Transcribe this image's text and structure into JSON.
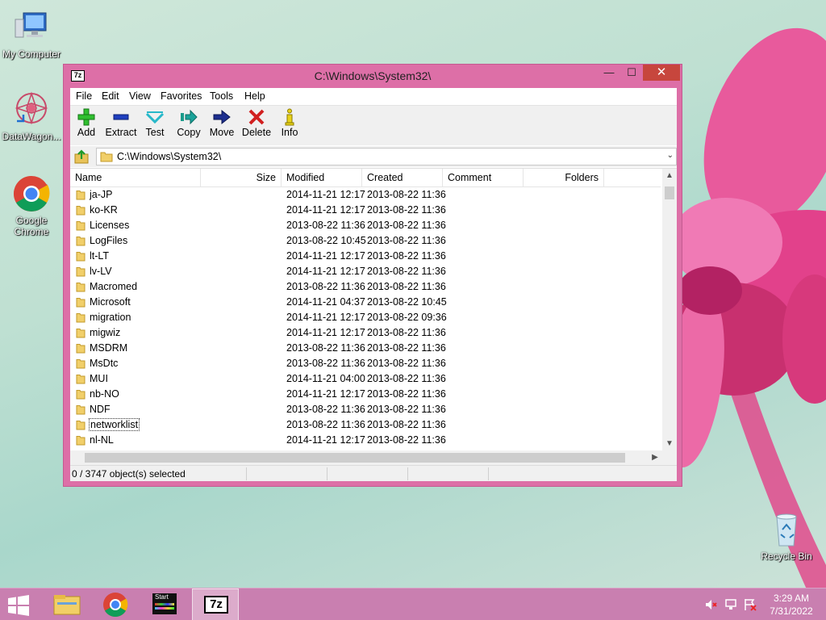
{
  "desktop": {
    "icons": [
      {
        "label": "My Computer"
      },
      {
        "label": "DataWagon..."
      },
      {
        "label": "Google Chrome"
      },
      {
        "label": "Recycle Bin"
      }
    ]
  },
  "window": {
    "app_icon_text": "7z",
    "title": "C:\\Windows\\System32\\",
    "controls": {
      "minimize": "—",
      "maximize": "☐",
      "close": "✕"
    }
  },
  "menu": [
    "File",
    "Edit",
    "View",
    "Favorites",
    "Tools",
    "Help"
  ],
  "toolbar": {
    "add": "Add",
    "extract": "Extract",
    "test": "Test",
    "copy": "Copy",
    "move": "Move",
    "delete": "Delete",
    "info": "Info"
  },
  "address": {
    "path": "C:\\Windows\\System32\\",
    "dropdown": "⌄"
  },
  "columns": {
    "name": "Name",
    "size": "Size",
    "modified": "Modified",
    "created": "Created",
    "comment": "Comment",
    "folders": "Folders"
  },
  "rows": [
    {
      "name": "ja-JP",
      "modified": "2014-11-21 12:17",
      "created": "2013-08-22 11:36"
    },
    {
      "name": "ko-KR",
      "modified": "2014-11-21 12:17",
      "created": "2013-08-22 11:36"
    },
    {
      "name": "Licenses",
      "modified": "2013-08-22 11:36",
      "created": "2013-08-22 11:36"
    },
    {
      "name": "LogFiles",
      "modified": "2013-08-22 10:45",
      "created": "2013-08-22 11:36"
    },
    {
      "name": "lt-LT",
      "modified": "2014-11-21 12:17",
      "created": "2013-08-22 11:36"
    },
    {
      "name": "lv-LV",
      "modified": "2014-11-21 12:17",
      "created": "2013-08-22 11:36"
    },
    {
      "name": "Macromed",
      "modified": "2013-08-22 11:36",
      "created": "2013-08-22 11:36"
    },
    {
      "name": "Microsoft",
      "modified": "2014-11-21 04:37",
      "created": "2013-08-22 10:45"
    },
    {
      "name": "migration",
      "modified": "2014-11-21 12:17",
      "created": "2013-08-22 09:36"
    },
    {
      "name": "migwiz",
      "modified": "2014-11-21 12:17",
      "created": "2013-08-22 11:36"
    },
    {
      "name": "MSDRM",
      "modified": "2013-08-22 11:36",
      "created": "2013-08-22 11:36"
    },
    {
      "name": "MsDtc",
      "modified": "2013-08-22 11:36",
      "created": "2013-08-22 11:36"
    },
    {
      "name": "MUI",
      "modified": "2014-11-21 04:00",
      "created": "2013-08-22 11:36"
    },
    {
      "name": "nb-NO",
      "modified": "2014-11-21 12:17",
      "created": "2013-08-22 11:36"
    },
    {
      "name": "NDF",
      "modified": "2013-08-22 11:36",
      "created": "2013-08-22 11:36"
    },
    {
      "name": "networklist",
      "modified": "2013-08-22 11:36",
      "created": "2013-08-22 11:36",
      "focused": true
    },
    {
      "name": "nl-NL",
      "modified": "2014-11-21 12:17",
      "created": "2013-08-22 11:36"
    }
  ],
  "status": {
    "selected": "0 / 3747 object(s) selected"
  },
  "taskbar": {
    "start_label": "Start",
    "active_app_text": "7z",
    "time": "3:29 AM",
    "date": "7/31/2022"
  },
  "colors": {
    "window_frame": "#dd6fa7",
    "taskbar": "#c97fb0",
    "close_button": "#c7463d",
    "add_icon": "#2fbf2f",
    "extract_icon": "#1f3fbf",
    "delete_icon": "#d11f1f"
  }
}
